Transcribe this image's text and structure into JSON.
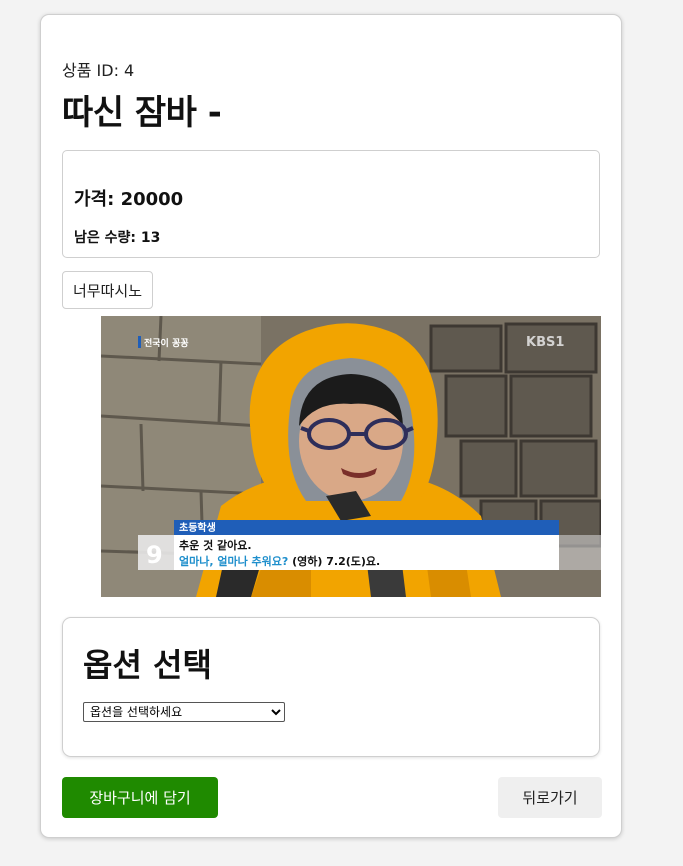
{
  "product": {
    "id_label": "상품 ID: 4",
    "title": "따신 잠바 -",
    "price_label": "가격: 20000",
    "stock_label": "남은 수량: 13",
    "tag_label": "너무따시노"
  },
  "photo": {
    "logo_text": "전국이 꽁꽁",
    "channel_text": "KBS1",
    "caption_channel": "9",
    "caption_name": "초등학생",
    "caption_line1": "추운 것 같아요.",
    "caption_line2_blue": "얼마나, 얼마나 추워요?",
    "caption_line2_rest": " (영하) 7.2(도)요."
  },
  "options": {
    "title": "옵션 선택",
    "select_selected": "옵션을 선택하세요"
  },
  "actions": {
    "cart_label": "장바구니에 담기",
    "back_label": "뒤로가기"
  },
  "colors": {
    "cart_green": "#1f8a00",
    "jacket_orange": "#f2a400",
    "caption_blue": "#1f5eb8"
  }
}
